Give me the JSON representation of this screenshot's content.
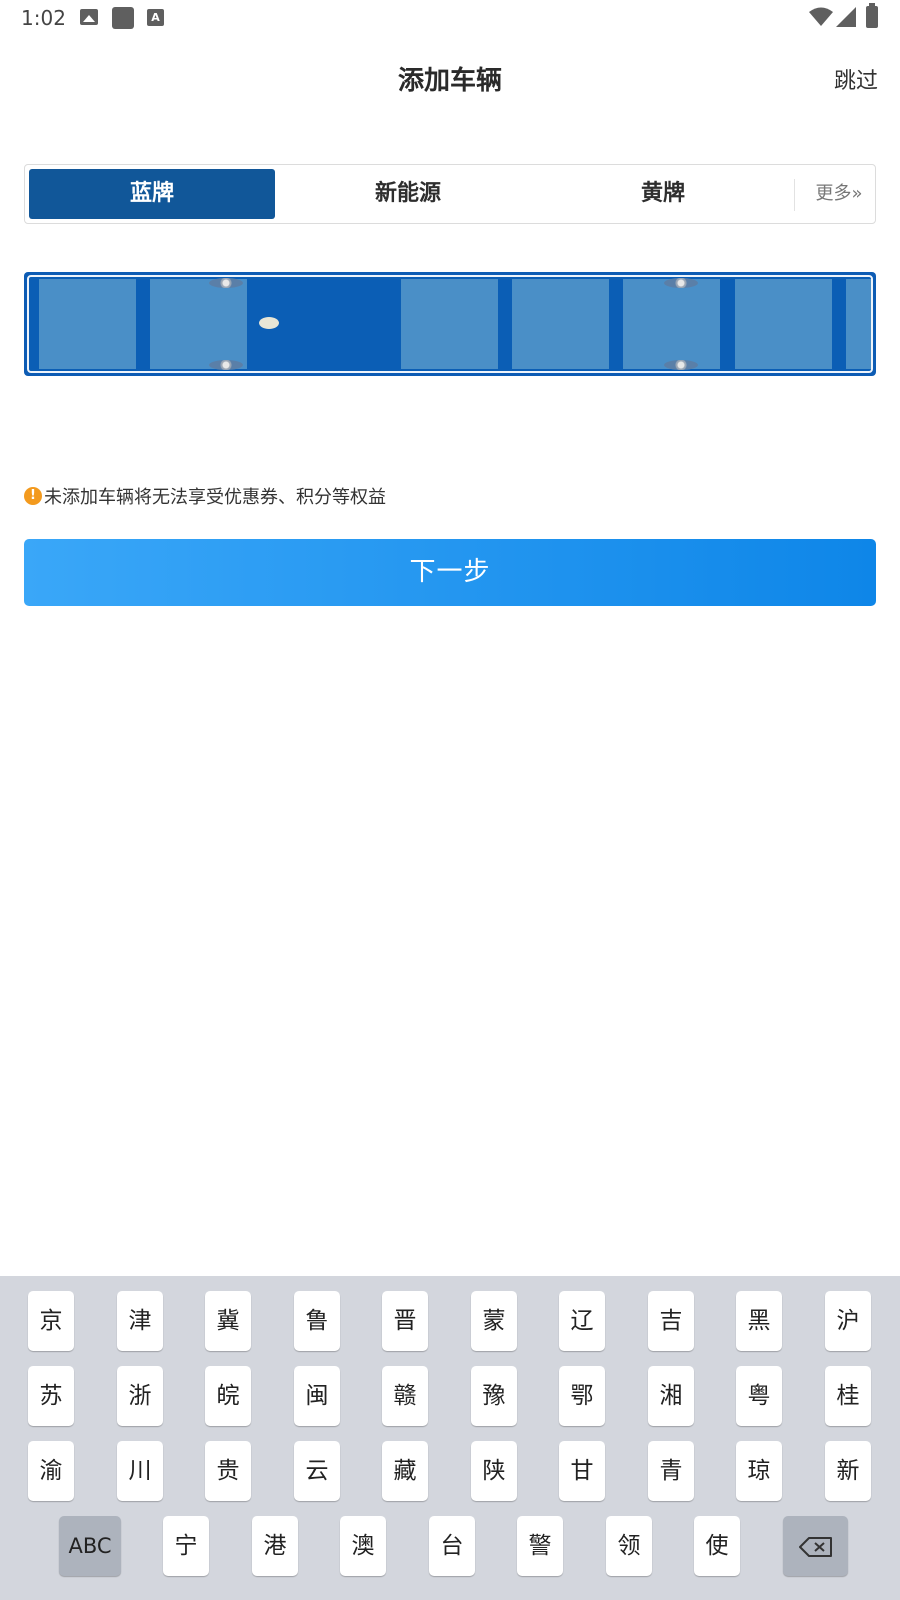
{
  "status_bar": {
    "time": "1:02",
    "icons": [
      "image-icon",
      "square-app-icon",
      "font-a-icon",
      "wifi-icon",
      "signal-icon",
      "battery-icon"
    ]
  },
  "header": {
    "title": "添加车辆",
    "skip_label": "跳过"
  },
  "plate_tabs": {
    "items": [
      {
        "label": "蓝牌",
        "selected": true
      },
      {
        "label": "新能源",
        "selected": false
      },
      {
        "label": "黄牌",
        "selected": false
      }
    ],
    "more_label": "更多»"
  },
  "plate": {
    "cell_count": 8,
    "active_cell": 2,
    "colors": {
      "plate": "#0d5cb4",
      "cell": "#4a8fc7",
      "active_cell": "#0b5eb5"
    }
  },
  "notice": {
    "icon": "warning-icon",
    "text": "未添加车辆将无法享受优惠券、积分等权益"
  },
  "next_button": {
    "label": "下一步"
  },
  "keyboard": {
    "rows": [
      [
        "京",
        "津",
        "冀",
        "鲁",
        "晋",
        "蒙",
        "辽",
        "吉",
        "黑",
        "沪"
      ],
      [
        "苏",
        "浙",
        "皖",
        "闽",
        "赣",
        "豫",
        "鄂",
        "湘",
        "粤",
        "桂"
      ],
      [
        "渝",
        "川",
        "贵",
        "云",
        "藏",
        "陕",
        "甘",
        "青",
        "琼",
        "新"
      ],
      [
        "宁",
        "港",
        "澳",
        "台",
        "警",
        "领",
        "使"
      ]
    ],
    "abc_label": "ABC",
    "backspace_icon": "backspace-icon"
  },
  "colors": {
    "accent": "#115799",
    "button_start": "#3aa7f8",
    "button_end": "#0e86e8",
    "warning": "#f39a1e"
  }
}
